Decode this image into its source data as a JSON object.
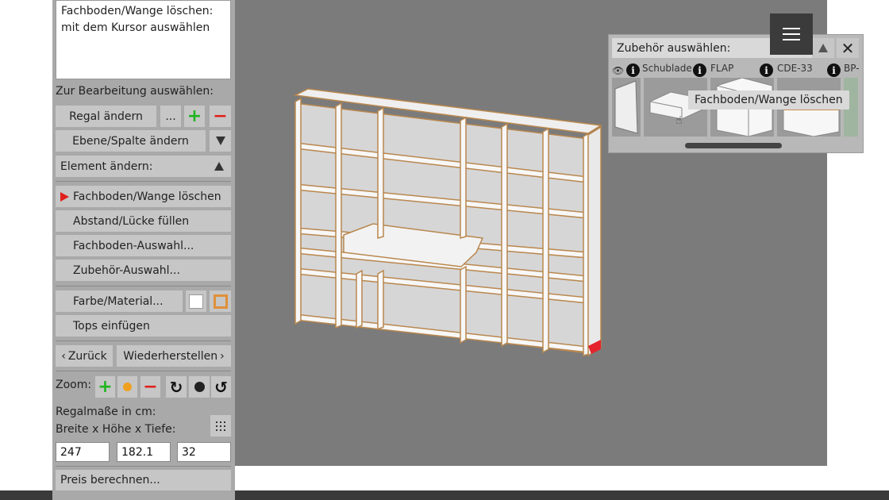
{
  "info_box": {
    "line1": "Fachboden/Wange löschen:",
    "line2": "mit dem Kursor auswählen"
  },
  "left_panel": {
    "select_label": "Zur Bearbeitung auswählen:",
    "regal_aendern": "Regal ändern",
    "more": "...",
    "plus": "+",
    "minus": "−",
    "ebene_spalte": "Ebene/Spalte ändern",
    "element_aendern": "Element ändern:",
    "fachboden_loeschen": "Fachboden/Wange löschen",
    "abstand": "Abstand/Lücke füllen",
    "fachboden_auswahl": "Fachboden-Auswahl...",
    "zubehoer_auswahl": "Zubehör-Auswahl...",
    "farbe": "Farbe/Material...",
    "tops": "Tops einfügen",
    "zurueck": "Zurück",
    "wiederherstellen": "Wiederherstellen",
    "zoom": "Zoom:",
    "masse": "Regalmaße in cm:",
    "dims_label": "Breite x Höhe x Tiefe:",
    "breite": "247",
    "hoehe": "182.1",
    "tiefe": "32",
    "preis": "Preis berechnen..."
  },
  "accessory_panel": {
    "title": "Zubehör auswählen:",
    "items": [
      "Schublade",
      "FLAP",
      "CDE-33",
      "BP-"
    ],
    "tooltip": "Fachboden/Wange löschen"
  },
  "colors": {
    "viewport": "#7b7b7b",
    "panel": "#a9a9a9",
    "button": "#c6c6c6",
    "plus_green": "#1fb51f",
    "minus_red": "#e0201b",
    "active_arrow": "#e0201b",
    "shelf_edge": "#c8904f"
  }
}
